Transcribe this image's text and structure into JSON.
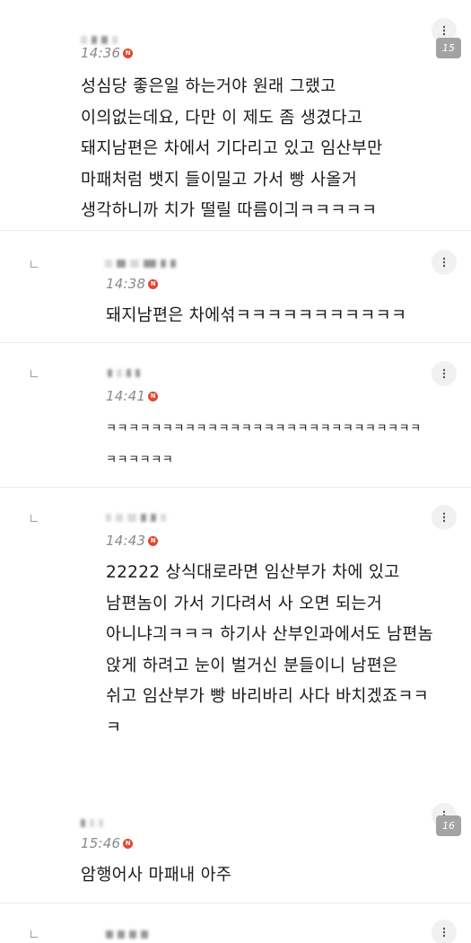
{
  "comments": [
    {
      "time": "14:36",
      "text": "성심당 좋은일 하는거야 원래 그랬고\n이의없는데요, 다만 이 제도 좀 생겼다고\n돼지남편은 차에서 기다리고 있고 임산부만\n마패처럼 뱃지 들이밀고 가서 빵 사올거\n생각하니까 치가 떨릴 따름이긔ㅋㅋㅋㅋㅋ",
      "page_badge": "15"
    },
    {
      "time": "14:38",
      "text": "돼지남편은 차에섞ㅋㅋㅋㅋㅋㅋㅋㅋㅋㅋㅋ"
    },
    {
      "time": "14:41",
      "text": "ㅋㅋㅋㅋㅋㅋㅋㅋㅋㅋㅋㅋㅋㅋㅋㅋㅋㅋㅋㅋㅋㅋㅋㅋㅋㅋㅋㅋ\nㅋㅋㅋㅋㅋㅋ"
    },
    {
      "time": "14:43",
      "text": "22222 상식대로라면 임산부가 차에 있고\n남편놈이 가서 기다려서 사 오면 되는거\n아니냐긔ㅋㅋㅋ 하기사 산부인과에서도 남편놈\n앉게 하려고 눈이 벌거신 분들이니 남편은\n쉬고 임산부가 빵 바리바리 사다 바치겠죠ㅋㅋ\nㅋ"
    },
    {
      "time": "15:46",
      "text": "암행어사 마패내 아주",
      "page_badge": "16"
    }
  ],
  "icons": {
    "more": "more-vertical-icon",
    "reply": "reply-corner-icon",
    "naver": "n-badge-icon"
  },
  "colors": {
    "n_badge": "#e8442e",
    "page_badge": "#a3a3a3"
  }
}
